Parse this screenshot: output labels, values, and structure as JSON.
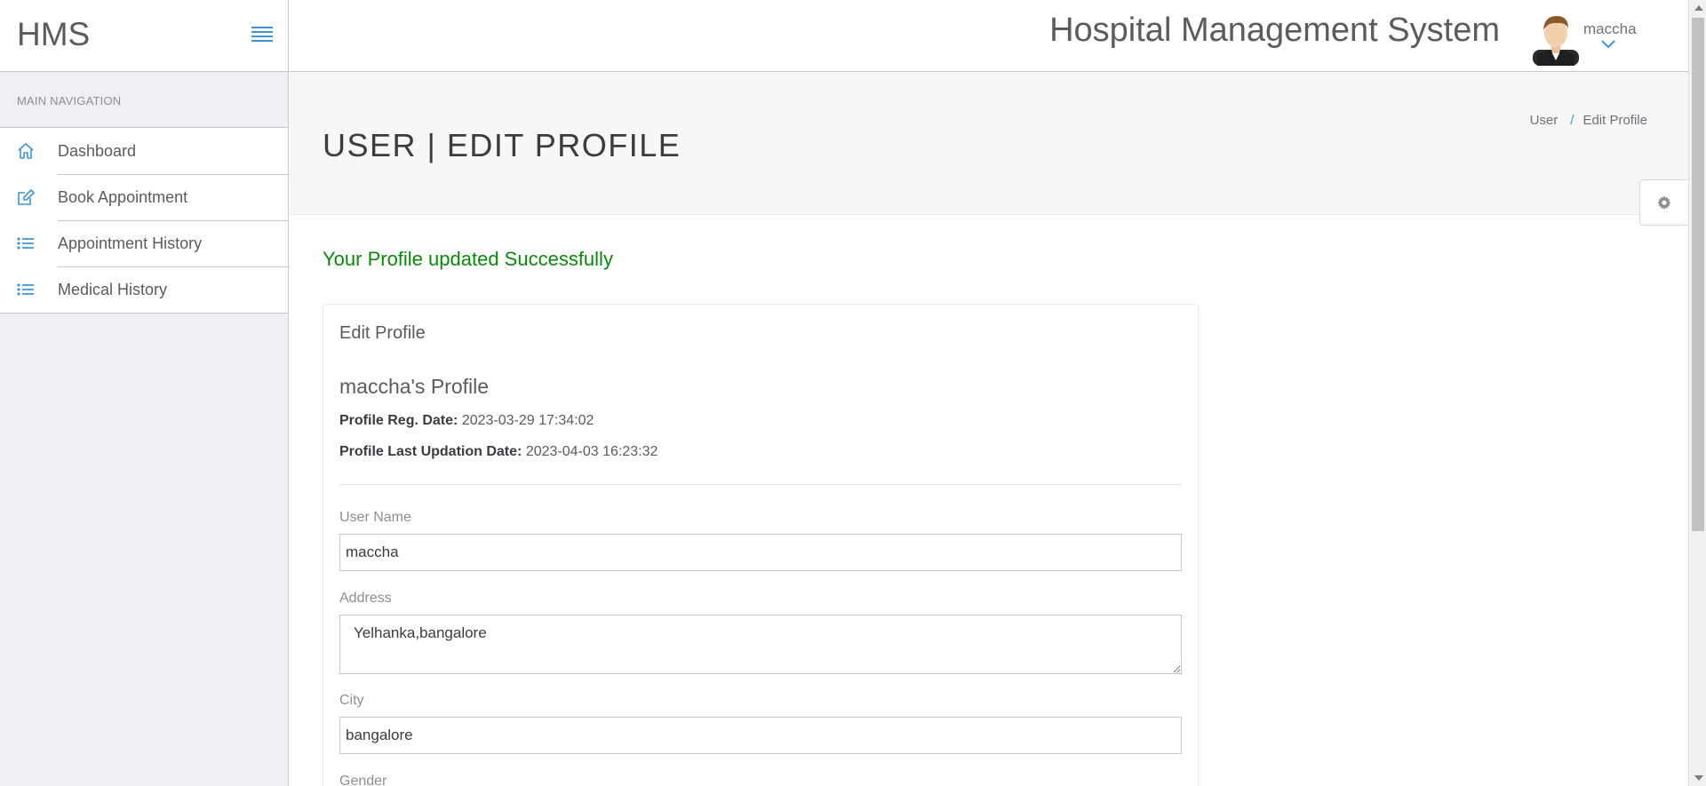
{
  "header": {
    "brand": "HMS",
    "app_title": "Hospital Management System",
    "user_name": "maccha"
  },
  "sidebar": {
    "heading": "MAIN NAVIGATION",
    "items": [
      {
        "label": "Dashboard",
        "icon": "home-icon"
      },
      {
        "label": "Book Appointment",
        "icon": "edit-icon"
      },
      {
        "label": "Appointment History",
        "icon": "list-icon"
      },
      {
        "label": "Medical History",
        "icon": "list-icon"
      }
    ]
  },
  "page": {
    "title": "USER | EDIT PROFILE",
    "breadcrumb": [
      "User",
      "/",
      "Edit Profile"
    ]
  },
  "message": "Your Profile updated Successfully",
  "panel": {
    "title": "Edit Profile",
    "profile_heading": "maccha's Profile",
    "reg_date_label": "Profile Reg. Date:",
    "reg_date_value": "2023-03-29 17:34:02",
    "update_date_label": "Profile Last Updation Date:",
    "update_date_value": "2023-04-03 16:23:32"
  },
  "form": {
    "username_label": "User Name",
    "username_value": "maccha",
    "address_label": "Address",
    "address_value": "Yelhanka,bangalore",
    "city_label": "City",
    "city_value": "bangalore",
    "gender_label": "Gender"
  },
  "colors": {
    "accent": "#3f95d4",
    "success": "#0a8a0a",
    "sidebar_bg": "#efeff4"
  }
}
